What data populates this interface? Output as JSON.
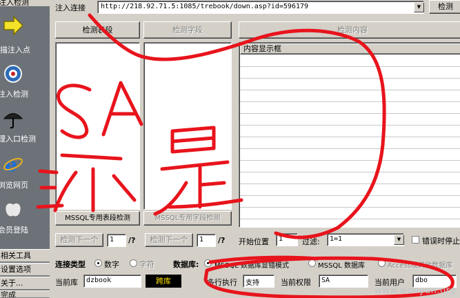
{
  "sidebar": {
    "title": "注入检测",
    "items": [
      {
        "label": "描注入点",
        "icon": "arrow-right-icon"
      },
      {
        "label": "注入检测",
        "icon": "target-icon"
      },
      {
        "label": "理入口检测",
        "icon": "umbrella-icon"
      },
      {
        "label": "浏览网页",
        "icon": "ie-browser-icon"
      },
      {
        "label": "会员登陆",
        "icon": "apple-icon"
      }
    ],
    "buttons": [
      "相关工具",
      "设置选项",
      "关于..."
    ],
    "footer": "完成"
  },
  "toolbar": {
    "url_label": "注入连接",
    "url_value": "http://218.92.71.5:1085/trebook/down.asp?id=596179",
    "detect_button": "检测"
  },
  "columns": {
    "detect_tables_button": "检测表段",
    "detect_fields_button": "检测字段",
    "detect_content_button": "检测内容",
    "content_header": "内容显示框",
    "mssql_table_button": "MSSQL专用表段检测",
    "mssql_field_button": "MSSQL专用字段检测"
  },
  "paging": {
    "next1_button": "检测下一个",
    "next1_value": "1",
    "next1_suffix": "/?",
    "next2_button": "检测下一个",
    "next2_value": "1",
    "next2_suffix": "/?",
    "start_label": "开始位置",
    "start_value": "1",
    "filter_label": "过滤:",
    "filter_value": "1=1",
    "error_stop_label": "错误时停止"
  },
  "conn": {
    "type_label": "连接类型",
    "type_options": [
      "数字",
      "字符"
    ],
    "db_label": "数据库:",
    "db_options": [
      "MSSQL 数据库显错模式",
      "MSSQL 数据库",
      "Access或其他数据库"
    ]
  },
  "status": {
    "db_label": "当前库",
    "db_value": "dzbook",
    "cross_db_button": "跨库",
    "multi_label": "多行执行",
    "multi_value": "支持",
    "perm_label": "当前权限",
    "perm_value": "SA",
    "user_label": "当前用户",
    "user_value": "dbo"
  },
  "watermark": "www.wooyun.org"
}
